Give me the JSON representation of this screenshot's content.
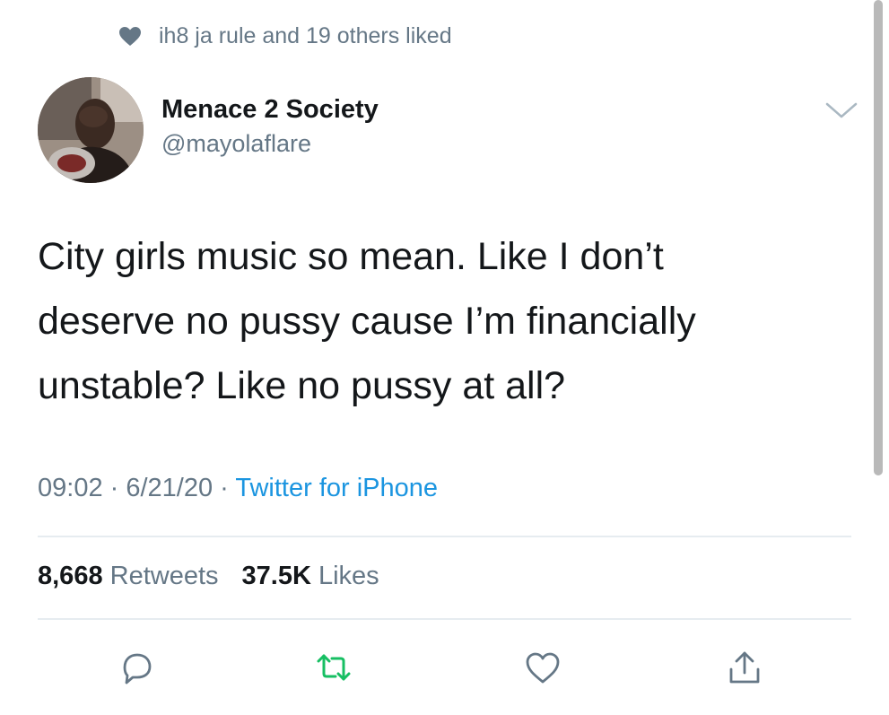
{
  "social_context": {
    "text": "ih8 ja rule and 19 others liked",
    "icon": "heart-icon"
  },
  "author": {
    "display_name": "Menace 2 Society",
    "handle": "@mayolaflare"
  },
  "tweet": {
    "lines": [
      "City girls music so mean. Like I don’t",
      "deserve no pussy cause I’m financially",
      "unstable? Like no pussy at all?"
    ]
  },
  "meta": {
    "time": "09:02",
    "separator": " · ",
    "date": "6/21/20",
    "source": "Twitter for iPhone"
  },
  "stats": {
    "retweets_count": "8,668",
    "retweets_label": "Retweets",
    "likes_count": "37.5K",
    "likes_label": "Likes"
  },
  "actions": [
    "reply-icon",
    "retweet-icon",
    "like-icon",
    "share-icon"
  ],
  "colors": {
    "text": "#14171a",
    "secondary": "#657786",
    "link": "#1b95e0",
    "retweet": "#17bf63",
    "divider": "#e6ecf0"
  }
}
